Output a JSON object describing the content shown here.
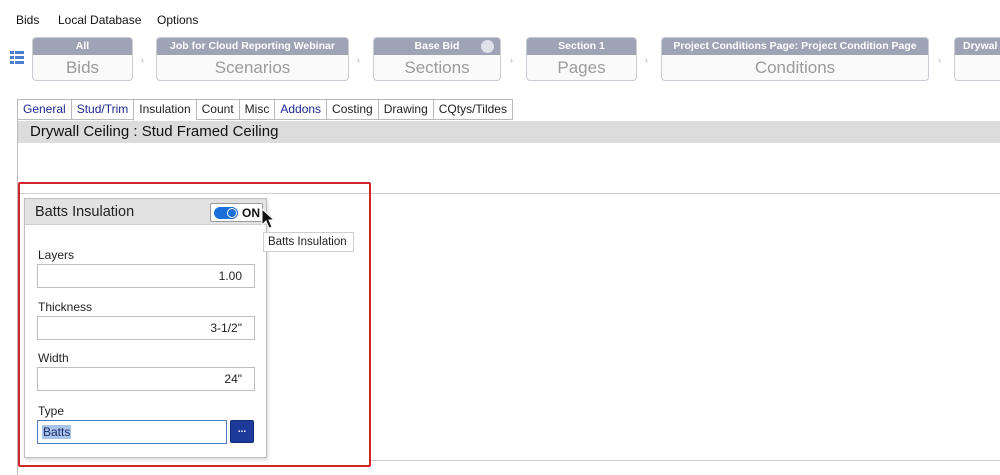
{
  "menu": {
    "items": [
      "Bids",
      "Local Database",
      "Options"
    ]
  },
  "breadcrumbs": [
    {
      "top": "All",
      "bottom": "Bids"
    },
    {
      "top": "Job for Cloud Reporting Webinar",
      "bottom": "Scenarios"
    },
    {
      "top": "Base Bid",
      "bottom": "Sections"
    },
    {
      "top": "Section 1",
      "bottom": "Pages"
    },
    {
      "top": "Project Conditions Page: Project Condition Page",
      "bottom": "Conditions"
    },
    {
      "top": "Drywal",
      "bottom": ""
    }
  ],
  "tabs": [
    "General",
    "Stud/Trim",
    "Insulation",
    "Count",
    "Misc",
    "Addons",
    "Costing",
    "Drawing",
    "CQtys/Tildes"
  ],
  "active_tab": "Insulation",
  "condition_title": "Drywall Ceiling : Stud Framed Ceiling",
  "card": {
    "title": "Batts Insulation",
    "toggle_label": "ON",
    "toggle_on": true,
    "layers_label": "Layers",
    "layers_value": "1.00",
    "thickness_label": "Thickness",
    "thickness_value": "3-1/2\"",
    "width_label": "Width",
    "width_value": "24\"",
    "type_label": "Type",
    "type_value": "Batts",
    "browse_label": "..."
  },
  "tooltip": "Batts Insulation",
  "colors": {
    "highlight_box": "#d3242b",
    "toggle_on": "#1a6fd8",
    "crumb_header": "#9ea3b5",
    "tab_link": "#1b2a8f"
  },
  "icons": {
    "grid": "grid-view-icon",
    "person": "person-icon",
    "cursor": "mouse-pointer-icon"
  }
}
